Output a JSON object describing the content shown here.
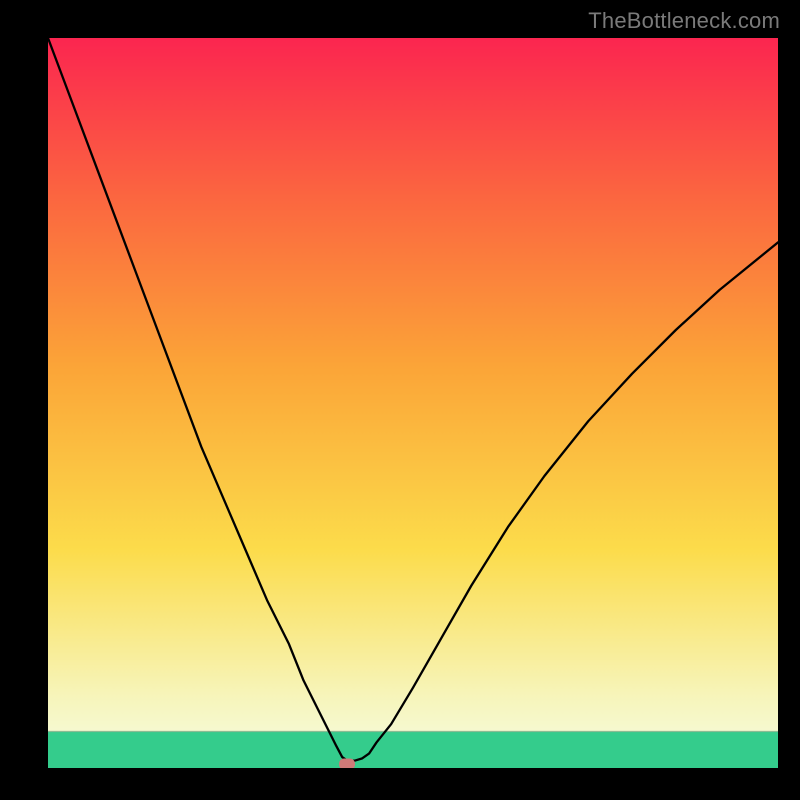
{
  "watermark": "TheBottleneck.com",
  "chart_data": {
    "type": "line",
    "title": "",
    "xlabel": "",
    "ylabel": "",
    "xlim": [
      0,
      100
    ],
    "ylim": [
      0,
      100
    ],
    "grid": false,
    "legend": false,
    "background_gradient": {
      "uniform_section": {
        "from_y_pct": 0,
        "to_y_pct": 5,
        "color": "#34cc8c"
      },
      "gradient_stops": [
        {
          "y_pct": 5,
          "color": "#f6f9d0"
        },
        {
          "y_pct": 10,
          "color": "#f7f5ba"
        },
        {
          "y_pct": 30,
          "color": "#fcdc4b"
        },
        {
          "y_pct": 55,
          "color": "#fba538"
        },
        {
          "y_pct": 78,
          "color": "#fb6740"
        },
        {
          "y_pct": 100,
          "color": "#fb2650"
        }
      ]
    },
    "series": [
      {
        "name": "bottleneck-curve",
        "color": "#000000",
        "x": [
          0,
          3,
          6,
          9,
          12,
          15,
          18,
          21,
          24,
          27,
          30,
          33,
          35,
          37,
          38.5,
          39.5,
          40.3,
          41,
          42,
          43,
          44,
          45,
          47,
          50,
          54,
          58,
          63,
          68,
          74,
          80,
          86,
          92,
          100
        ],
        "y": [
          100,
          92,
          84,
          76,
          68,
          60,
          52,
          44,
          37,
          30,
          23,
          17,
          12,
          8,
          5,
          3,
          1.5,
          1,
          1,
          1.3,
          2,
          3.5,
          6,
          11,
          18,
          25,
          33,
          40,
          47.5,
          54,
          60,
          65.5,
          72
        ]
      }
    ],
    "marker": {
      "x": 41,
      "y": 0.5,
      "color": "#cf7a78"
    }
  }
}
